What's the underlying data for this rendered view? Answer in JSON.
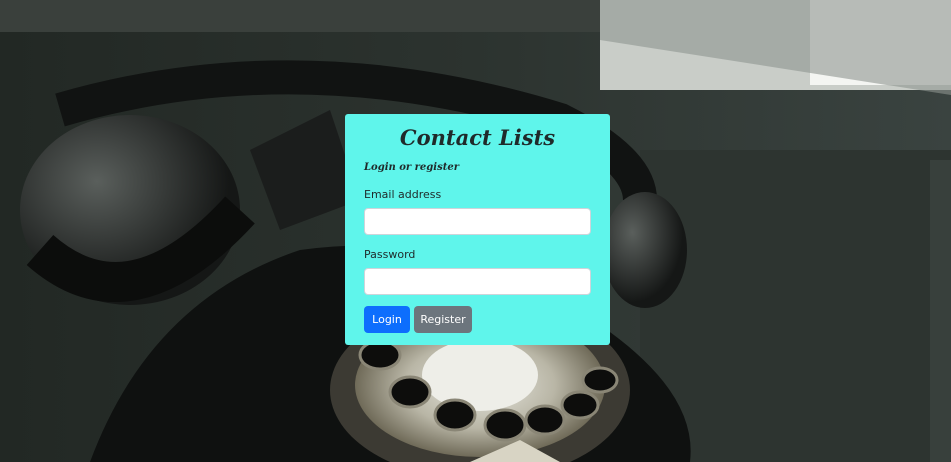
{
  "card": {
    "title": "Contact Lists",
    "subtitle": "Login or register",
    "email_label": "Email address",
    "email_value": "",
    "password_label": "Password",
    "password_value": "",
    "login_label": "Login",
    "register_label": "Register"
  },
  "colors": {
    "card_background": "#5ff5eb",
    "login_button": "#0d6efd",
    "register_button": "#6c757d"
  },
  "background": {
    "description_icon": "rotary-telephone-photo"
  }
}
